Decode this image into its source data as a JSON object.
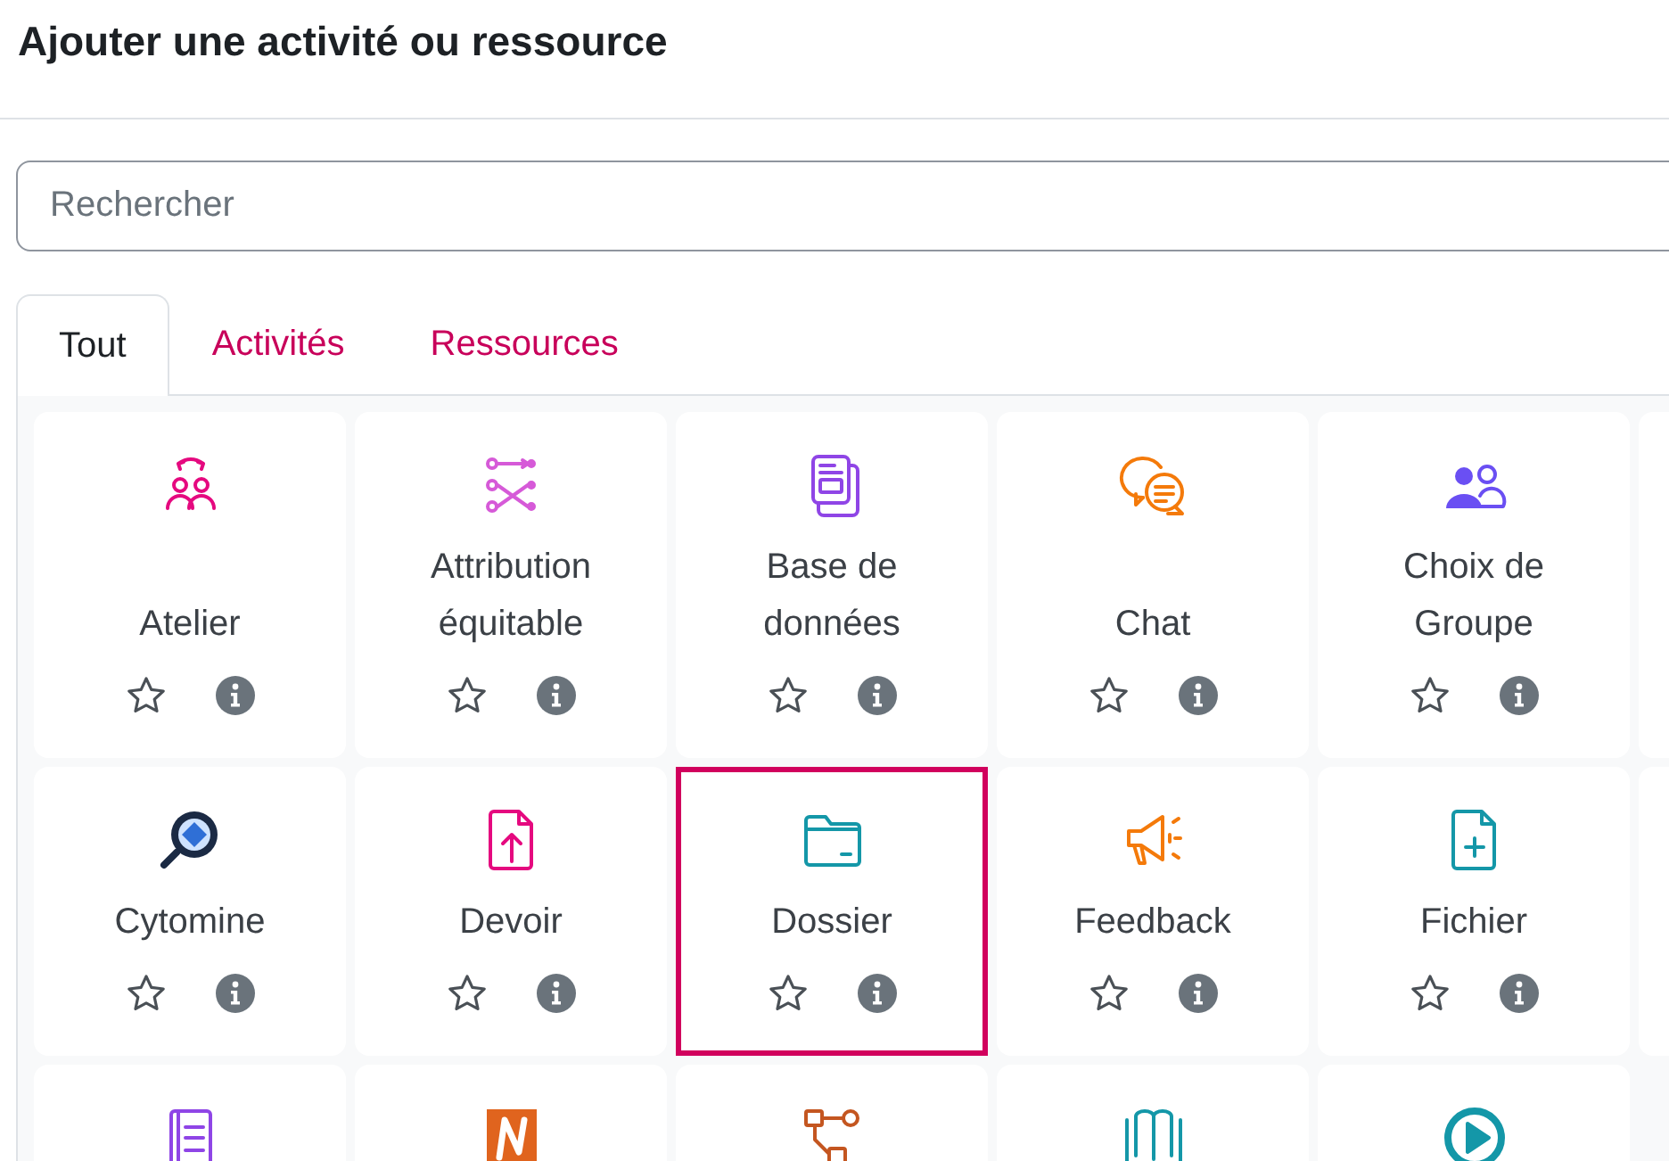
{
  "title": "Ajouter une activité ou ressource",
  "search": {
    "placeholder": "Rechercher"
  },
  "tabs": [
    {
      "label": "Tout",
      "selected": true
    },
    {
      "label": "Activités",
      "selected": false
    },
    {
      "label": "Ressources",
      "selected": false
    }
  ],
  "items": [
    {
      "kind": "module",
      "color": "#e5097f",
      "name": "Atelier",
      "selected": false
    },
    {
      "kind": "module",
      "color": "#d65ad8",
      "name": "Attribution équitable",
      "selected": false
    },
    {
      "kind": "module",
      "color": "#8f45e6",
      "name": "Base de données",
      "selected": false
    },
    {
      "kind": "module",
      "color": "#f47a0a",
      "name": "Chat",
      "selected": false
    },
    {
      "kind": "module",
      "color": "#6a4ff3",
      "name": "Choix de Groupe",
      "selected": false
    },
    {
      "kind": "cut"
    },
    {
      "kind": "module",
      "color": "#1b2a44",
      "name": "Cytomine",
      "selected": false
    },
    {
      "kind": "module",
      "color": "#e5097f",
      "name": "Devoir",
      "selected": false
    },
    {
      "kind": "module",
      "color": "#1497a8",
      "name": "Dossier",
      "selected": true
    },
    {
      "kind": "module",
      "color": "#f47a0a",
      "name": "Feedback",
      "selected": false
    },
    {
      "kind": "module",
      "color": "#1497a8",
      "name": "Fichier",
      "selected": false
    },
    {
      "kind": "cut"
    },
    {
      "kind": "module",
      "color": "#8f45e6"
    },
    {
      "kind": "module",
      "color": "#e0641e"
    },
    {
      "kind": "module",
      "color": "#c45620"
    },
    {
      "kind": "module",
      "color": "#1497a8"
    },
    {
      "kind": "module",
      "color": "#1497a8"
    }
  ]
}
